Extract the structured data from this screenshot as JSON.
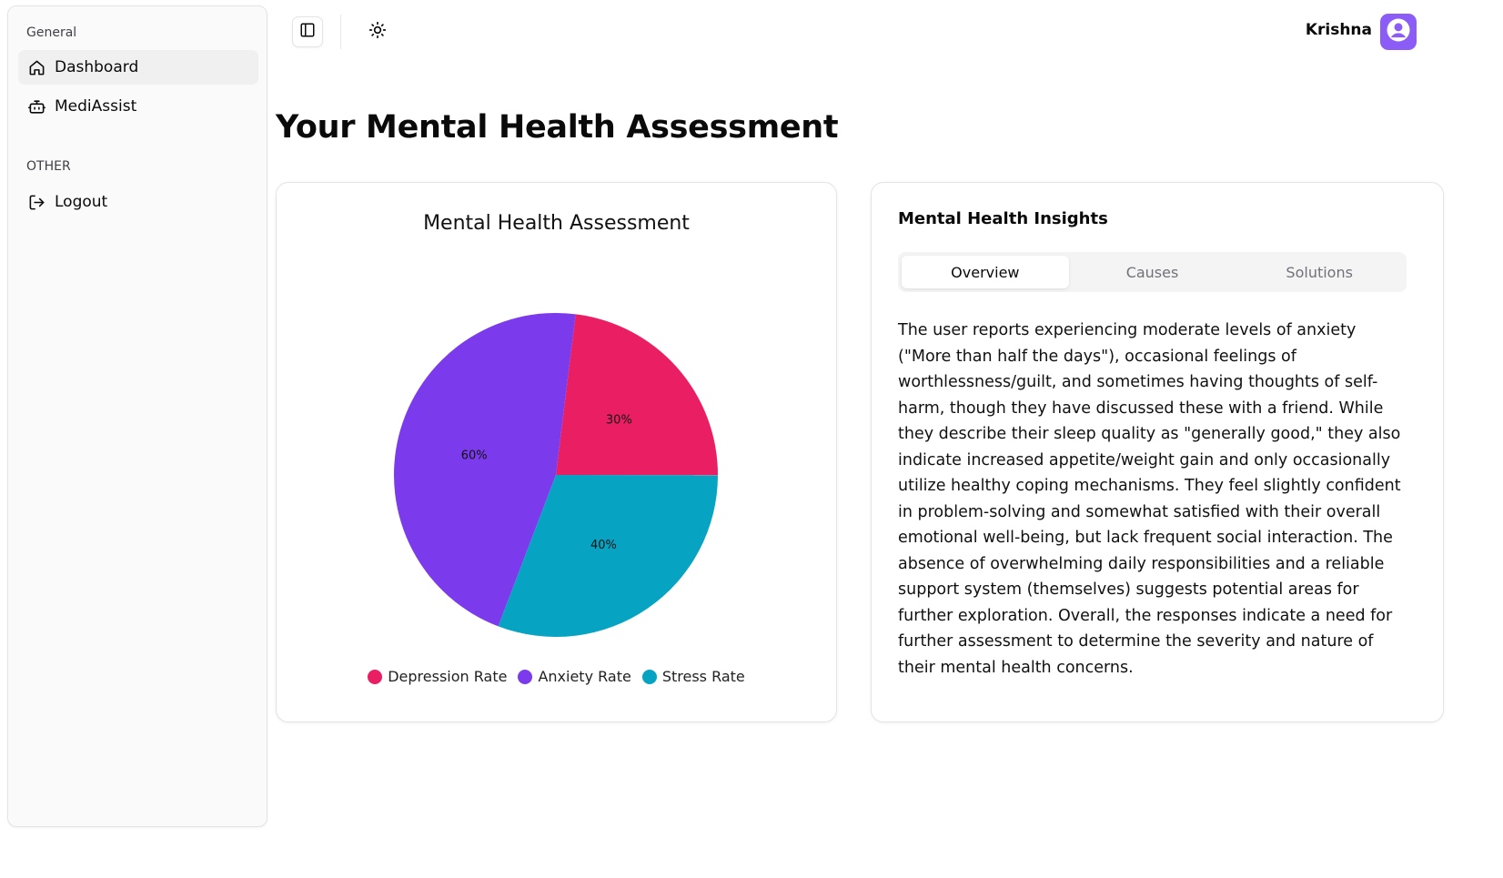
{
  "sidebar": {
    "general_label": "General",
    "other_label": "OTHER",
    "items": [
      {
        "label": "Dashboard",
        "icon": "home-icon",
        "active": true
      },
      {
        "label": "MediAssist",
        "icon": "bot-icon",
        "active": false
      },
      {
        "label": "Logout",
        "icon": "logout-icon",
        "active": false
      }
    ]
  },
  "header": {
    "toggle_icon": "panel-left-icon",
    "theme_icon": "sun-icon",
    "user_name": "Krishna",
    "avatar_icon": "user-icon"
  },
  "page": {
    "title": "Your Mental Health Assessment"
  },
  "chart_data": {
    "type": "pie",
    "title": "Mental Health Assessment",
    "categories": [
      "Depression Rate",
      "Anxiety Rate",
      "Stress Rate"
    ],
    "values": [
      30,
      60,
      40
    ],
    "labels": [
      "30%",
      "60%",
      "40%"
    ],
    "colors": [
      "#e91e63",
      "#7c3aed",
      "#06a3c2"
    ],
    "legend": "bottom"
  },
  "insights": {
    "title": "Mental Health Insights",
    "tabs": [
      "Overview",
      "Causes",
      "Solutions"
    ],
    "active_tab": "Overview",
    "overview_text": "The user reports experiencing moderate levels of anxiety (\"More than half the days\"), occasional feelings of worthlessness/guilt, and sometimes having thoughts of self-harm, though they have discussed these with a friend. While they describe their sleep quality as \"generally good,\" they also indicate increased appetite/weight gain and only occasionally utilize healthy coping mechanisms. They feel slightly confident in problem-solving and somewhat satisfied with their overall emotional well-being, but lack frequent social interaction. The absence of overwhelming daily responsibilities and a reliable support system (themselves) suggests potential areas for further exploration. Overall, the responses indicate a need for further assessment to determine the severity and nature of their mental health concerns."
  },
  "colors": {
    "accent": "#8b5cf6",
    "border": "#e4e4e7",
    "sidebar_bg": "#fafafa"
  }
}
